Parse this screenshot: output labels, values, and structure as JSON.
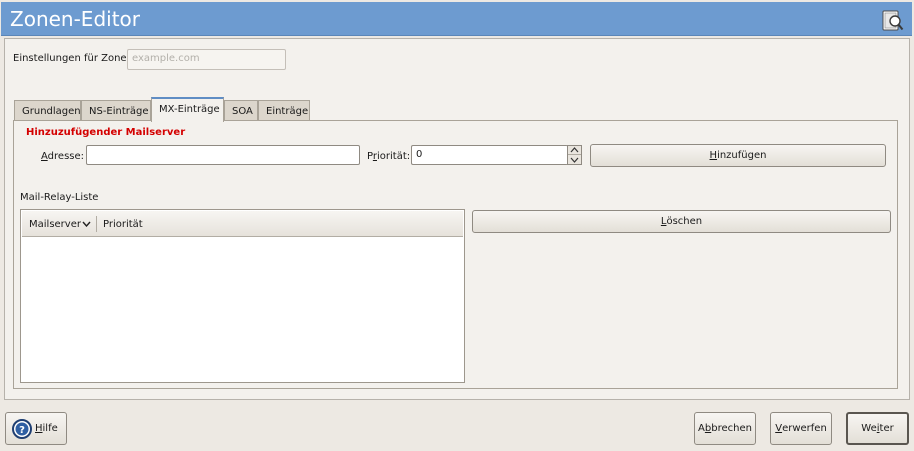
{
  "window": {
    "title": "Zonen-Editor",
    "icon": "help-book-icon"
  },
  "zone": {
    "label": "Einstellungen für Zone",
    "placeholder": "example.com"
  },
  "tabs": [
    {
      "label": "Grundlagen",
      "active": false
    },
    {
      "label": "NS-Einträge",
      "active": false
    },
    {
      "label": "MX-Einträge",
      "active": true
    },
    {
      "label": "SOA",
      "active": false
    },
    {
      "label": "Einträge",
      "active": false
    }
  ],
  "mx": {
    "section_title": "Hinzuzufügender Mailserver",
    "address_label_pre": "",
    "address_label_u": "A",
    "address_label_post": "dresse:",
    "address_value": "",
    "priority_label_pre": "P",
    "priority_label_u": "r",
    "priority_label_post": "iorität:",
    "priority_value": "0",
    "add_pre": "",
    "add_u": "H",
    "add_post": "inzufügen"
  },
  "relay": {
    "label": "Mail-Relay-Liste",
    "columns": [
      "Mailserver",
      "Priorität"
    ],
    "sort_icon": "chevron-down-icon",
    "rows": [],
    "delete_pre": "",
    "delete_u": "L",
    "delete_post": "öschen"
  },
  "footer": {
    "help_pre": "",
    "help_u": "H",
    "help_post": "ilfe",
    "cancel_pre": "A",
    "cancel_u": "b",
    "cancel_post": "brechen",
    "discard_pre": "",
    "discard_u": "V",
    "discard_post": "erwerfen",
    "next_pre": "We",
    "next_u": "i",
    "next_post": "ter"
  },
  "colors": {
    "titlebar": "#6d9bd0",
    "accent_red": "#d40000",
    "active_tab_border": "#5f8dc4"
  }
}
